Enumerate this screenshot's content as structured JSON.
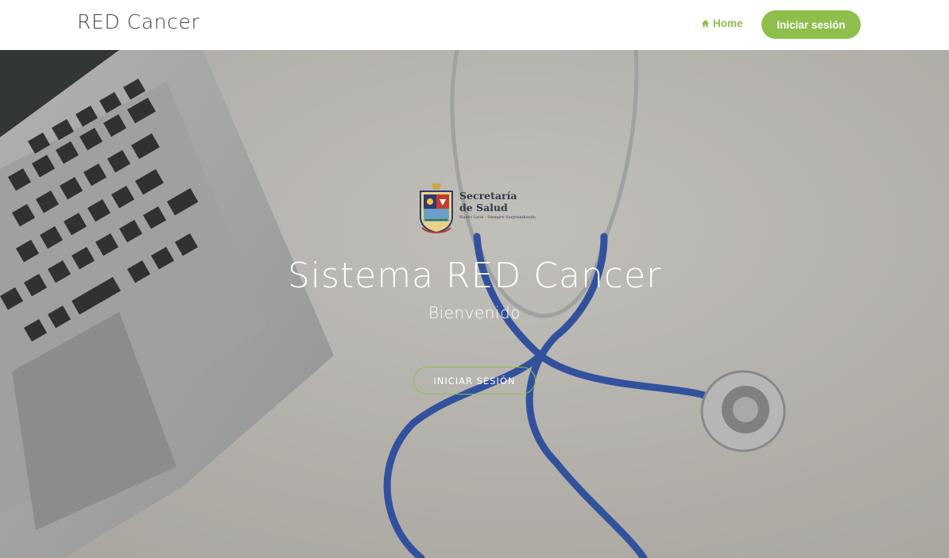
{
  "navbar": {
    "brand": "RED Cancer",
    "home_label": "Home",
    "home_icon": "home-icon",
    "login_label": "Iniciar sesión"
  },
  "hero": {
    "logo": {
      "title_line1": "Secretaría",
      "title_line2": "de Salud",
      "subtitle": "Nuevo León · Siempre Sorprendiendo"
    },
    "title": "Sistema RED Cancer",
    "subtitle": "Bienvenido",
    "button_label": "INICIAR SESIÓN"
  },
  "colors": {
    "accent": "#8dbf4a",
    "nav_text": "#444444",
    "hero_text": "#ffffff"
  }
}
